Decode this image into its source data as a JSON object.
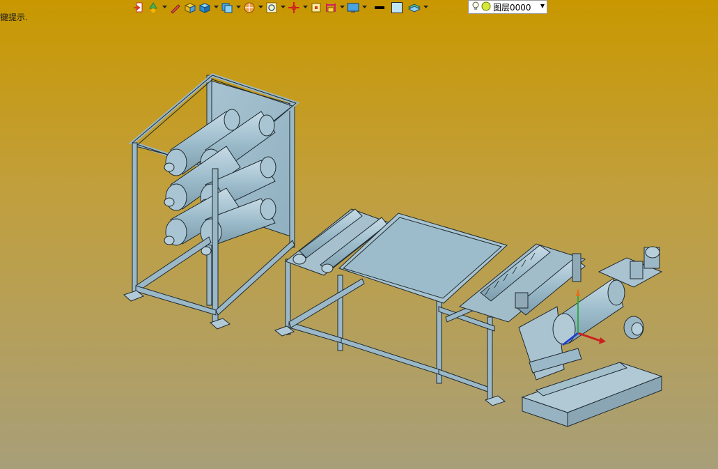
{
  "hint": {
    "text": "键提示."
  },
  "toolbar": {
    "items": [
      {
        "icon": "exit-icon",
        "has_dropdown": false
      },
      {
        "icon": "recycle-icon",
        "has_dropdown": true
      },
      {
        "icon": "pencil-icon",
        "has_dropdown": false
      },
      {
        "icon": "box-yellow-icon",
        "has_dropdown": false
      },
      {
        "icon": "box-blue-icon",
        "has_dropdown": true
      },
      {
        "icon": "view-cube-icon",
        "has_dropdown": true
      },
      {
        "icon": "orbit-icon",
        "has_dropdown": true
      },
      {
        "icon": "zoom-window-icon",
        "has_dropdown": true
      },
      {
        "icon": "pan-icon",
        "has_dropdown": true
      },
      {
        "icon": "fit-icon",
        "has_dropdown": false
      },
      {
        "icon": "section-icon",
        "has_dropdown": true
      },
      {
        "icon": "display-icon",
        "has_dropdown": true
      },
      {
        "icon": "line-color-icon",
        "has_dropdown": false
      },
      {
        "icon": "fill-color-icon",
        "has_dropdown": false
      },
      {
        "icon": "layer-stack-icon",
        "has_dropdown": true
      }
    ]
  },
  "layer": {
    "current": "图层0000"
  },
  "colors": {
    "model_fill": "#9ab8c8",
    "model_stroke": "#1e2a30",
    "background_top": "#c99800",
    "background_bottom": "#a89f79"
  }
}
